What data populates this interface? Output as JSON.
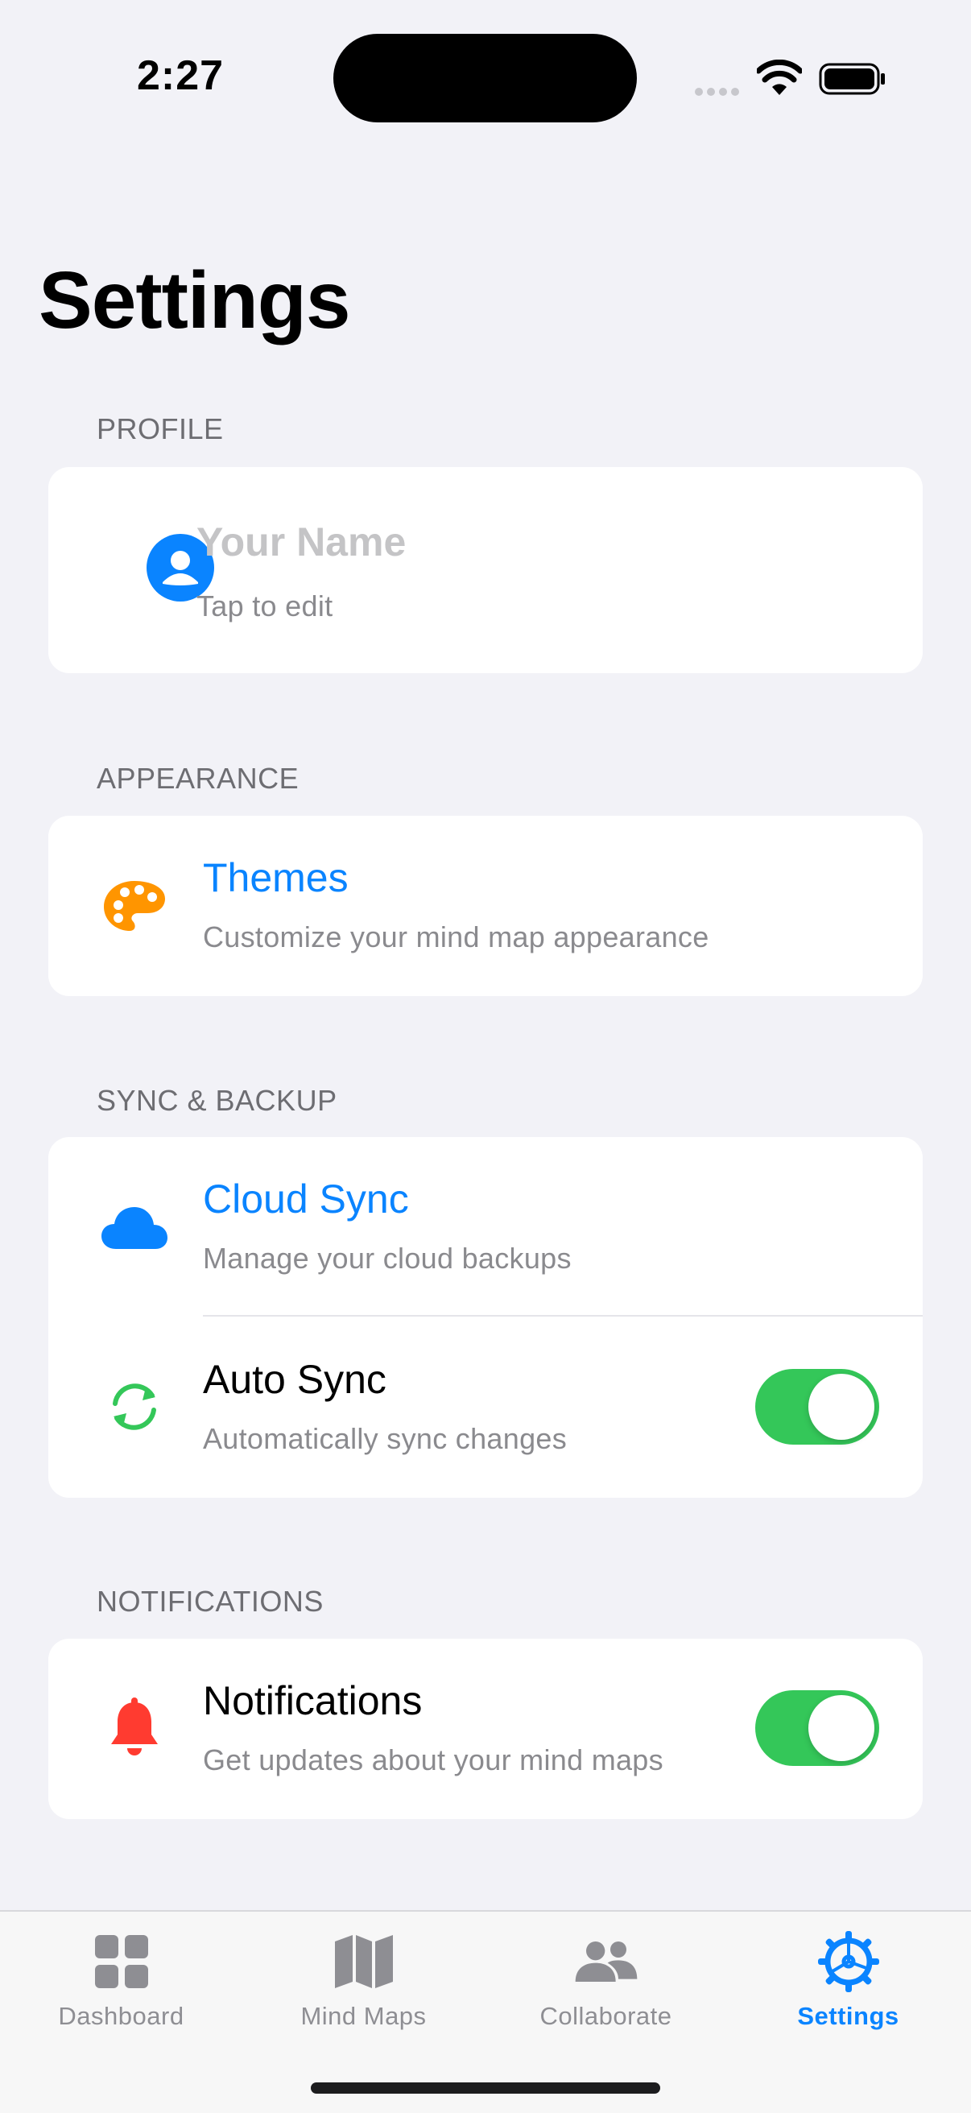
{
  "status_bar": {
    "time": "2:27"
  },
  "page": {
    "title": "Settings"
  },
  "colors": {
    "accent": "#0a84ff",
    "toggle_on": "#34c759",
    "orange": "#ff9500",
    "red": "#ff3b30",
    "green": "#34c759"
  },
  "sections": {
    "profile": {
      "header": "PROFILE",
      "name_placeholder": "Your Name",
      "hint": "Tap to edit",
      "icon": "person-circle-icon"
    },
    "appearance": {
      "header": "APPEARANCE",
      "themes": {
        "title": "Themes",
        "subtitle": "Customize your mind map appearance",
        "icon": "palette-icon"
      }
    },
    "sync": {
      "header": "SYNC & BACKUP",
      "cloud": {
        "title": "Cloud Sync",
        "subtitle": "Manage your cloud backups",
        "icon": "cloud-icon"
      },
      "auto": {
        "title": "Auto Sync",
        "subtitle": "Automatically sync changes",
        "icon": "sync-arrows-icon",
        "enabled": true
      }
    },
    "notifications": {
      "header": "NOTIFICATIONS",
      "item": {
        "title": "Notifications",
        "subtitle": "Get updates about your mind maps",
        "icon": "bell-icon",
        "enabled": true
      }
    }
  },
  "tabbar": {
    "tabs": [
      {
        "label": "Dashboard",
        "icon": "dashboard-grid-icon",
        "active": false
      },
      {
        "label": "Mind Maps",
        "icon": "map-icon",
        "active": false
      },
      {
        "label": "Collaborate",
        "icon": "people-icon",
        "active": false
      },
      {
        "label": "Settings",
        "icon": "gear-icon",
        "active": true
      }
    ]
  }
}
